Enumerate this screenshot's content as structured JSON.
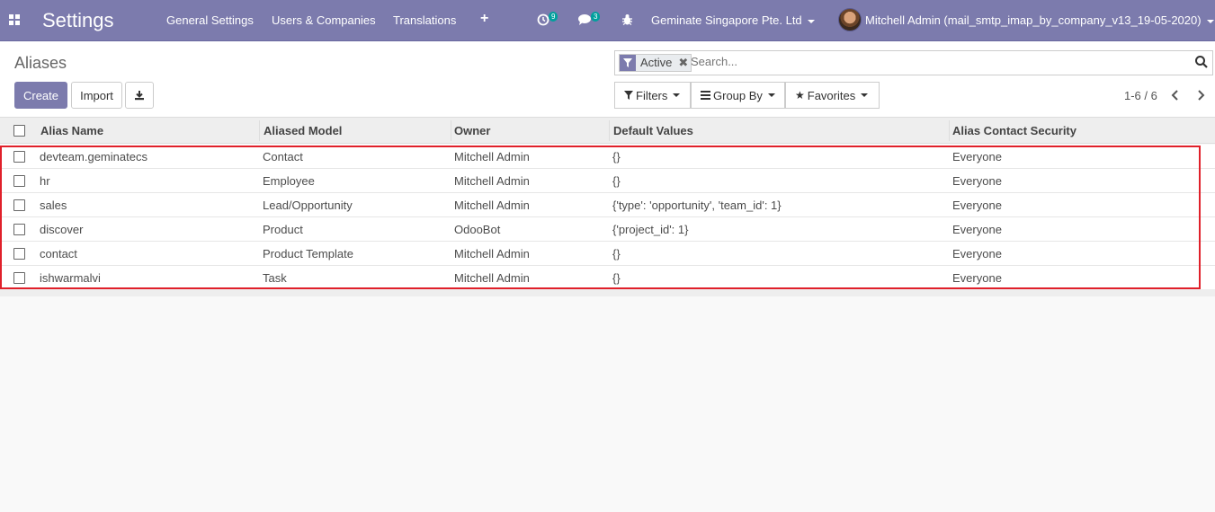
{
  "navbar": {
    "app_title": "Settings",
    "menus": [
      "General Settings",
      "Users & Companies",
      "Translations"
    ],
    "activity_count": "9",
    "message_count": "3",
    "company": "Geminate Singapore Pte. Ltd",
    "user": "Mitchell Admin (mail_smtp_imap_by_company_v13_19-05-2020)"
  },
  "page": {
    "title": "Aliases",
    "create_label": "Create",
    "import_label": "Import"
  },
  "search": {
    "facet_label": "Active",
    "placeholder": "Search...",
    "filters_label": "Filters",
    "groupby_label": "Group By",
    "favorites_label": "Favorites"
  },
  "pager": {
    "text": "1-6 / 6"
  },
  "table": {
    "columns": [
      "Alias Name",
      "Aliased Model",
      "Owner",
      "Default Values",
      "Alias Contact Security"
    ],
    "rows": [
      [
        "devteam.geminatecs",
        "Contact",
        "Mitchell Admin",
        "{}",
        "Everyone"
      ],
      [
        "hr",
        "Employee",
        "Mitchell Admin",
        "{}",
        "Everyone"
      ],
      [
        "sales",
        "Lead/Opportunity",
        "Mitchell Admin",
        "{'type': 'opportunity', 'team_id': 1}",
        "Everyone"
      ],
      [
        "discover",
        "Product",
        "OdooBot",
        "{'project_id': 1}",
        "Everyone"
      ],
      [
        "contact",
        "Product Template",
        "Mitchell Admin",
        "{}",
        "Everyone"
      ],
      [
        "ishwarmalvi",
        "Task",
        "Mitchell Admin",
        "{}",
        "Everyone"
      ]
    ]
  },
  "colors": {
    "navbar": "#7c7bad",
    "badge": "#00a09d",
    "highlight": "#e0202a"
  }
}
